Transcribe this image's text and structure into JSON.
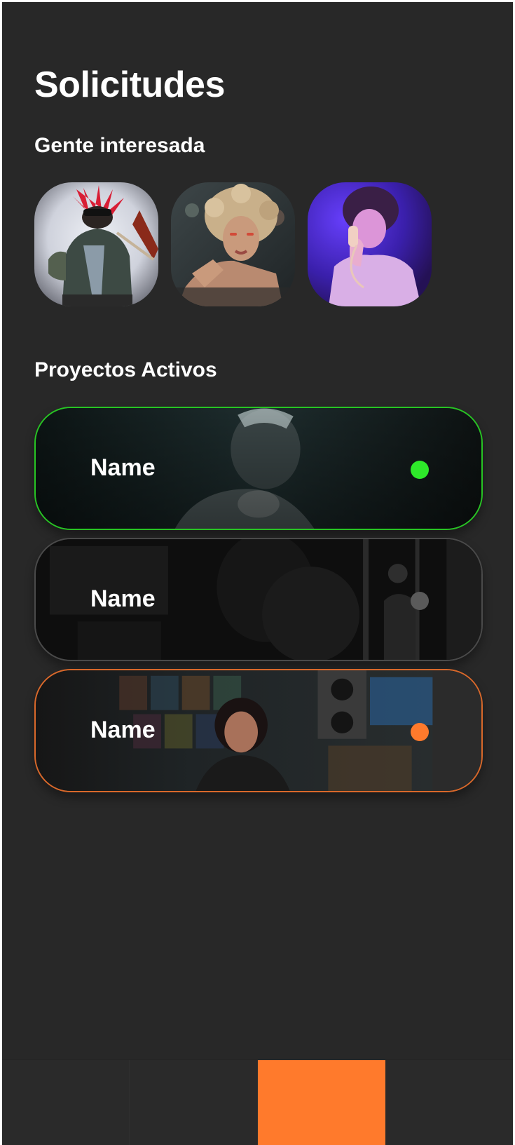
{
  "header": {
    "title": "Solicitudes"
  },
  "interested": {
    "title": "Gente interesada",
    "people": [
      {
        "photo": "person-with-guitar-photo"
      },
      {
        "photo": "person-curly-hair-photo"
      },
      {
        "photo": "person-phone-photo"
      }
    ]
  },
  "projects": {
    "title": "Proyectos Activos",
    "items": [
      {
        "name": "Name",
        "status_color": "#2ee82a",
        "border_color": "#27c423"
      },
      {
        "name": "Name",
        "status_color": "#5a5a5a",
        "border_color": "#4a4a4a"
      },
      {
        "name": "Name",
        "status_color": "#ff7a2c",
        "border_color": "#d9682a"
      }
    ]
  },
  "nav": {
    "active_color": "#ff7a2c",
    "active_index": 2
  },
  "colors": {
    "background": "#282828",
    "text": "#ffffff",
    "accent": "#ff7a2c"
  }
}
